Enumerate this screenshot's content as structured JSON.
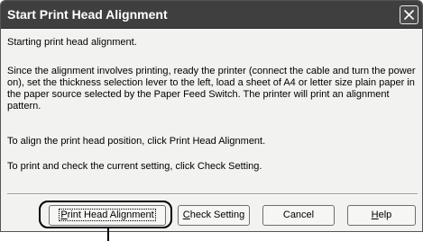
{
  "window": {
    "title": "Start Print Head Alignment"
  },
  "body": {
    "line1": "Starting print head alignment.",
    "line2": "Since the alignment involves printing, ready the printer (connect the cable and turn the power on), set the thickness selection lever to the left, load a sheet of A4 or letter size plain paper in the paper source selected by the Paper Feed Switch. The printer will print an alignment pattern.",
    "line3": "To align the print head position, click Print Head Alignment.",
    "line4": "To print and check the current setting, click Check Setting."
  },
  "buttons": {
    "print_head_alignment": {
      "label": "Print Head Alignment",
      "mnemonic": "P",
      "rest": "rint Head Alignment"
    },
    "check_setting": {
      "label": "Check Setting",
      "mnemonic": "C",
      "rest": "heck Setting"
    },
    "cancel": {
      "label": "Cancel"
    },
    "help": {
      "label": "Help",
      "mnemonic": "H",
      "rest": "elp"
    }
  },
  "icons": {
    "close": "close-icon"
  },
  "colors": {
    "titlebar": "#3f3f3f",
    "dialog_background": "#f2f2f0",
    "callout": "#000000"
  }
}
